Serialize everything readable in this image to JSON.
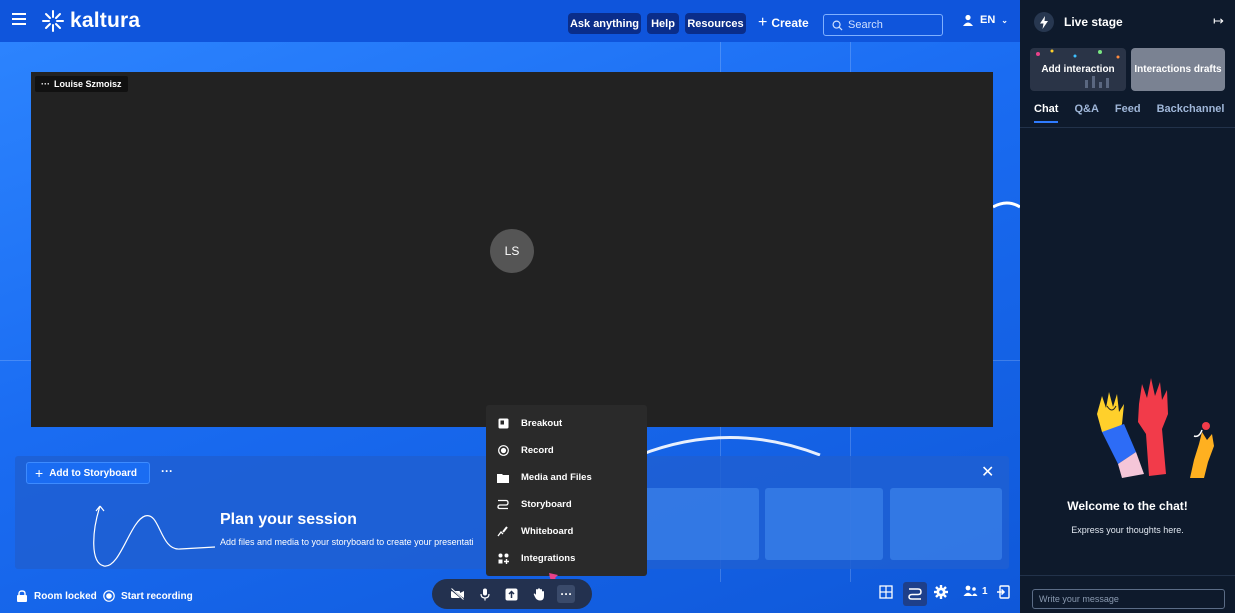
{
  "header": {
    "brand": "kaltura",
    "ask_label": "Ask anything",
    "help_label": "Help",
    "resources_label": "Resources",
    "create_label": "Create",
    "search_placeholder": "Search",
    "language": "EN"
  },
  "stage": {
    "participant_name": "Louise Szmoisz",
    "participant_initials": "LS"
  },
  "storyboard": {
    "add_label": "Add to Storyboard",
    "more_label": "···",
    "title": "Plan your session",
    "subtitle": "Add files and media to your storyboard to create your presentati"
  },
  "more_menu": {
    "items": [
      {
        "label": "Breakout",
        "icon": "breakout-icon"
      },
      {
        "label": "Record",
        "icon": "record-icon"
      },
      {
        "label": "Media and Files",
        "icon": "folder-icon"
      },
      {
        "label": "Storyboard",
        "icon": "storyboard-icon"
      },
      {
        "label": "Whiteboard",
        "icon": "whiteboard-icon"
      },
      {
        "label": "Integrations",
        "icon": "integrations-icon"
      }
    ]
  },
  "bottom_bar": {
    "room_locked": "Room locked",
    "start_recording": "Start recording",
    "participants_count": "1"
  },
  "side_panel": {
    "title": "Live stage",
    "add_interaction": "Add interaction",
    "interactions_drafts": "Interactions drafts",
    "tabs": [
      "Chat",
      "Q&A",
      "Feed",
      "Backchannel"
    ],
    "welcome_title": "Welcome to the chat!",
    "welcome_subtitle": "Express your thoughts here.",
    "message_placeholder": "Write your message"
  },
  "colors": {
    "accent": "#1a6cf2",
    "topbar": "#0f55dc",
    "panel": "#0e1a2c",
    "pill": "#0a2d8a",
    "arrow": "#e8418a"
  }
}
